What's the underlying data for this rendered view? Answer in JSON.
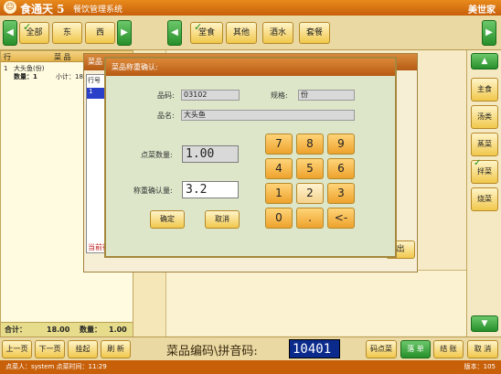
{
  "app": {
    "name": "食通天 5",
    "subtitle": "餐饮管理系统",
    "brand": "美世家"
  },
  "top": {
    "left_arrow": "◀",
    "right_arrow": "▶",
    "areas": [
      "全部",
      "东",
      "西"
    ],
    "categories": [
      "堂食",
      "其他",
      "酒水",
      "套餐"
    ],
    "selected_area": "全部",
    "selected_category": "堂食"
  },
  "order_panel": {
    "headers": {
      "index": "行",
      "name": "菜 品"
    },
    "rows": [
      {
        "index": "1",
        "name": "大头鱼(份)",
        "qty_label": "数量：1",
        "subtotal_label": "小计：18"
      }
    ],
    "total_label": "合计：",
    "total_value": "18.00",
    "count_label": "数量：",
    "count_value": "1.00"
  },
  "right_sidebar": {
    "up_arrow": "▲",
    "down_arrow": "▼",
    "items": [
      "主食",
      "汤类",
      "蒸菜",
      "拌菜",
      "烧菜"
    ],
    "checked": "拌菜"
  },
  "bottom": {
    "buttons": [
      "上一页",
      "下一页",
      "挂起",
      "刷 新"
    ],
    "code_label": "菜品编码\\拼音码:",
    "code_value": "10401",
    "right_buttons": [
      "码点菜",
      "落 单",
      "结 账",
      "取 消"
    ]
  },
  "status": {
    "text": "点菜人：system   点菜时间：11:29",
    "version": "版本：105"
  },
  "bg_dialog": {
    "title": "菜品",
    "col": "行号",
    "row1": "1",
    "foot": "当前行",
    "button": "出"
  },
  "dialog": {
    "title": "菜品称重确认:",
    "code_label": "品码:",
    "code_value": "03102",
    "spec_label": "规格:",
    "spec_value": "份",
    "name_label": "品名:",
    "name_value": "大头鱼",
    "qty_label": "点菜数量:",
    "qty_value": "1.00",
    "confirm_qty_label": "称重确认量:",
    "confirm_qty_value": "3.2",
    "confirm_button": "确定",
    "cancel_button": "取消",
    "keys": [
      "7",
      "8",
      "9",
      "4",
      "5",
      "6",
      "1",
      "2",
      "3",
      "0",
      ".",
      "<-"
    ]
  }
}
